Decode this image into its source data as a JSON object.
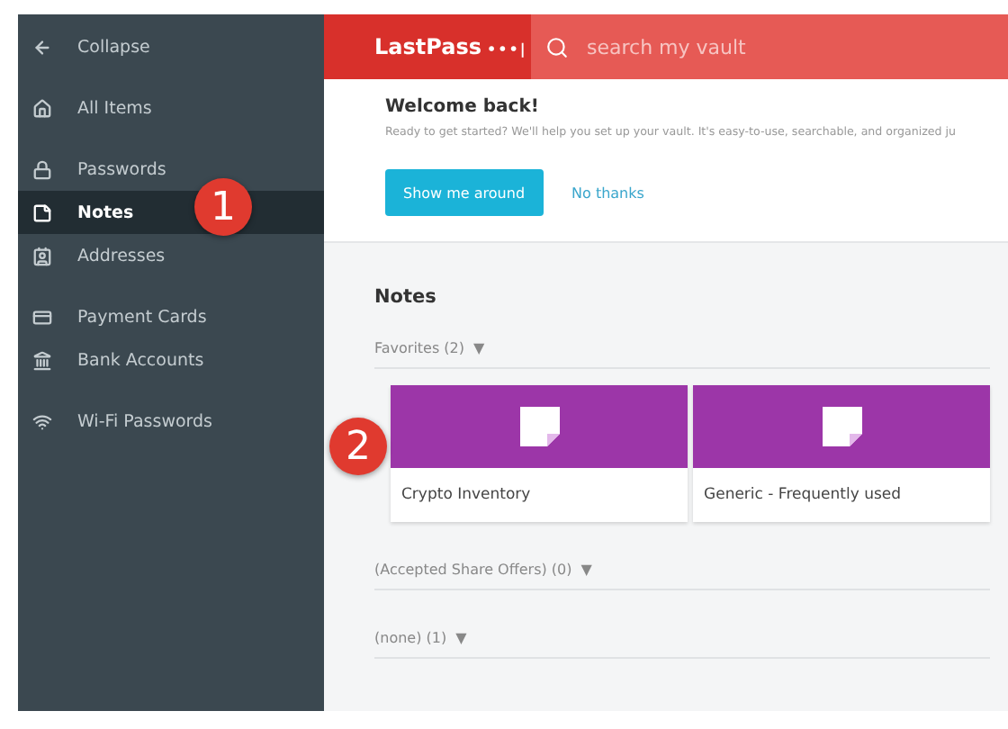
{
  "sidebar": {
    "groups": [
      [
        {
          "label": "Collapse",
          "selected": false
        }
      ],
      [
        {
          "label": "All Items",
          "selected": false
        }
      ],
      [
        {
          "label": "Passwords",
          "selected": false
        },
        {
          "label": "Notes",
          "selected": true
        },
        {
          "label": "Addresses",
          "selected": false
        }
      ],
      [
        {
          "label": "Payment Cards",
          "selected": false
        },
        {
          "label": "Bank Accounts",
          "selected": false
        }
      ],
      [
        {
          "label": "Wi-Fi Passwords",
          "selected": false
        }
      ]
    ]
  },
  "header": {
    "logo": "LastPass",
    "logo_mark": "•••|",
    "search": {
      "placeholder": "search my vault"
    }
  },
  "welcome": {
    "title": "Welcome back!",
    "text": "Ready to get started? We'll help you set up your vault. It's easy-to-use, searchable, and organized ju",
    "primary_button": "Show me around",
    "secondary_button": "No thanks"
  },
  "notes": {
    "title": "Notes",
    "sections": [
      {
        "label": "Favorites (2)",
        "toggle": "▼",
        "items": [
          {
            "name": "Crypto Inventory"
          },
          {
            "name": "Generic - Frequently used"
          }
        ]
      },
      {
        "label": "(Accepted Share Offers) (0)",
        "toggle": "▼"
      },
      {
        "label": "(none) (1)",
        "toggle": "▼"
      }
    ]
  },
  "callouts": [
    "1",
    "2"
  ]
}
